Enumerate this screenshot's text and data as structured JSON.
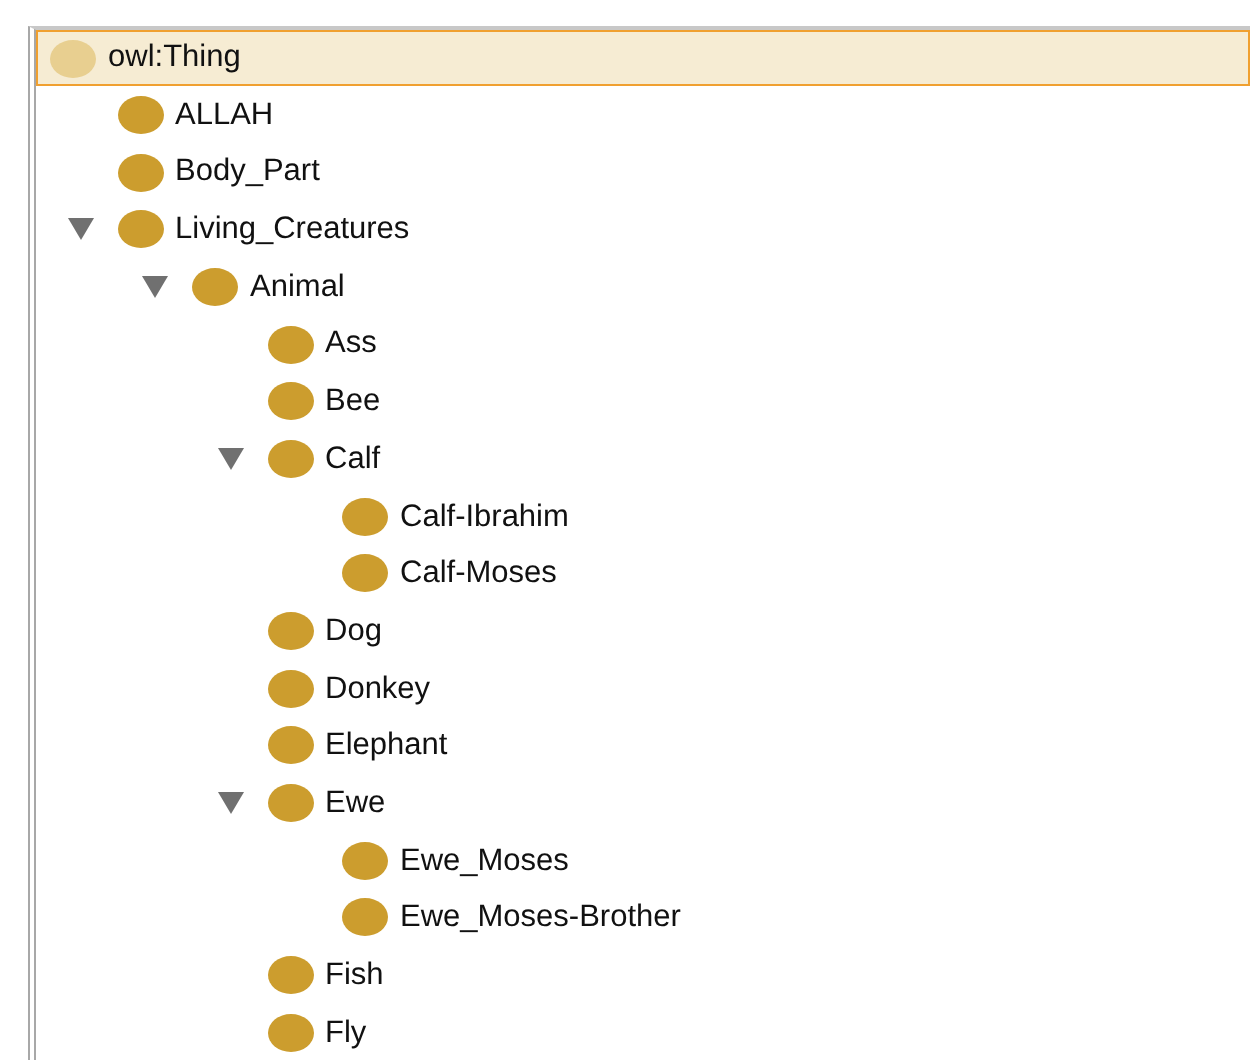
{
  "class_tree": {
    "root": {
      "label": "owl:Thing",
      "selected": true,
      "children": [
        {
          "label": "ALLAH",
          "selected": false
        },
        {
          "label": "Body_Part",
          "selected": false
        },
        {
          "label": "Living_Creatures",
          "selected": false,
          "expanded": true,
          "children": [
            {
              "label": "Animal",
              "selected": false,
              "expanded": true,
              "children": [
                {
                  "label": "Ass",
                  "selected": false
                },
                {
                  "label": "Bee",
                  "selected": false
                },
                {
                  "label": "Calf",
                  "selected": false,
                  "expanded": true,
                  "children": [
                    {
                      "label": "Calf-Ibrahim",
                      "selected": false
                    },
                    {
                      "label": "Calf-Moses",
                      "selected": false
                    }
                  ]
                },
                {
                  "label": "Dog",
                  "selected": false
                },
                {
                  "label": "Donkey",
                  "selected": false
                },
                {
                  "label": "Elephant",
                  "selected": false
                },
                {
                  "label": "Ewe",
                  "selected": false,
                  "expanded": true,
                  "children": [
                    {
                      "label": "Ewe_Moses",
                      "selected": false
                    },
                    {
                      "label": "Ewe_Moses-Brother",
                      "selected": false
                    }
                  ]
                },
                {
                  "label": "Fish",
                  "selected": false
                },
                {
                  "label": "Fly",
                  "selected": false
                }
              ]
            }
          ]
        }
      ]
    }
  }
}
